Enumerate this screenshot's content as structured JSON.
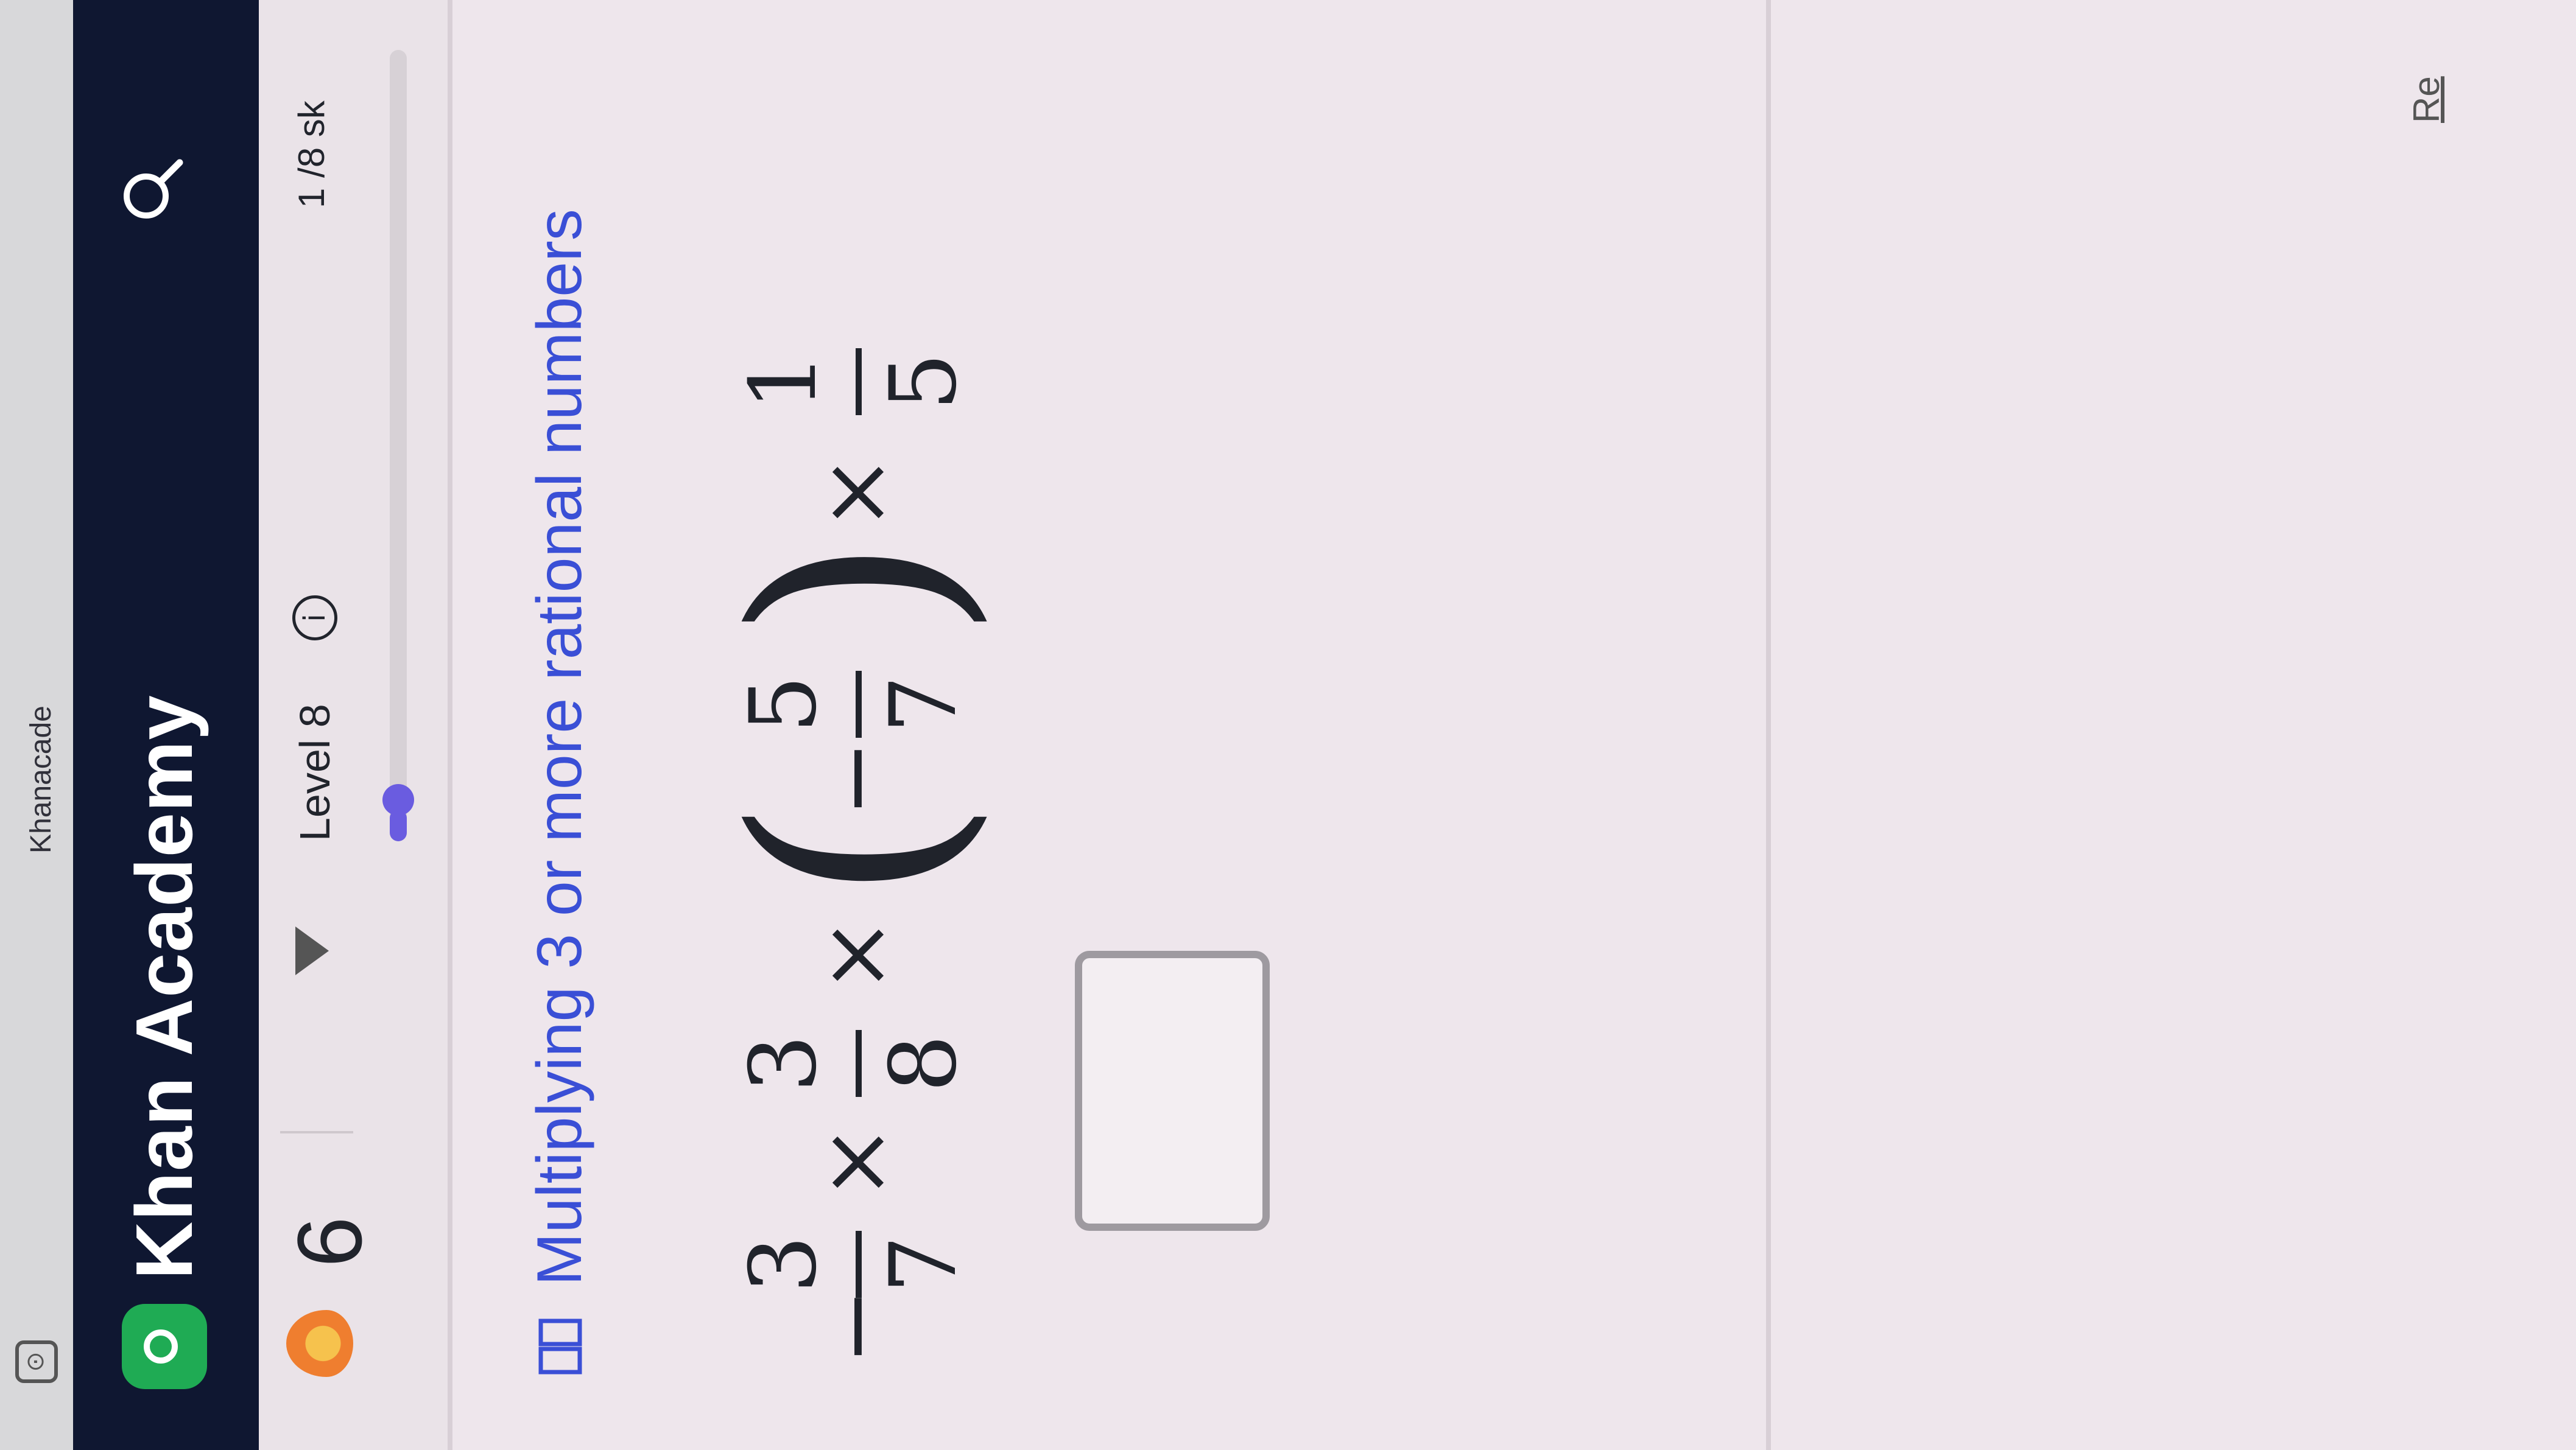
{
  "browser": {
    "title_fragment": "Khanacade"
  },
  "header": {
    "brand": "Khan Academy"
  },
  "level": {
    "streak_count": "6",
    "label": "Level 8",
    "info_glyph": "i",
    "counter": "1 /8 sk",
    "progress": 0.04
  },
  "exercise": {
    "skill_title": "Multiplying 3 or more rational numbers",
    "expression": {
      "lead_sign": "−",
      "f1": {
        "num": "3",
        "den": "7"
      },
      "times": "×",
      "f2": {
        "num": "3",
        "den": "8"
      },
      "open_paren": "(",
      "inner_sign": "−",
      "f3": {
        "num": "5",
        "den": "7"
      },
      "close_paren": ")",
      "f4": {
        "num": "1",
        "den": "5"
      }
    }
  },
  "footer": {
    "link": "Re"
  },
  "colors": {
    "header_bg": "#0f1731",
    "accent": "#3a4fd6",
    "progress": "#6a5ce0",
    "logo": "#1fab54"
  },
  "icons": {
    "logo": "khan-academy-logo-icon",
    "search": "search-icon",
    "streak": "streak-flame-icon",
    "info": "info-icon",
    "skill": "book-icon"
  }
}
